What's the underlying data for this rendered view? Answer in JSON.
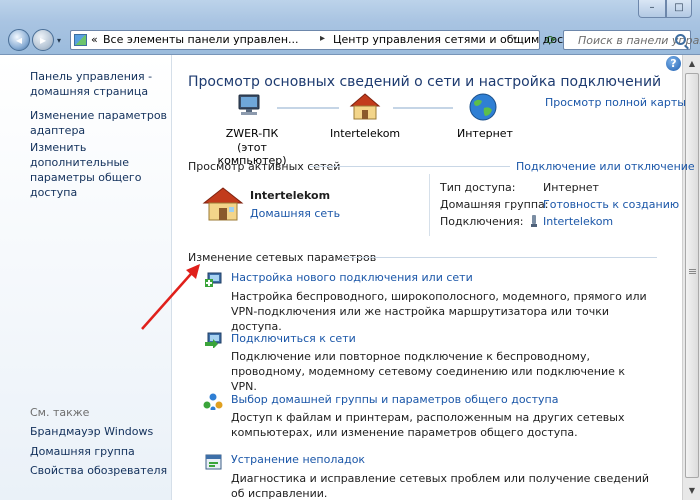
{
  "window": {
    "min_label": "–",
    "max_label": "□"
  },
  "address": {
    "crumb_prefix": "«",
    "crumb1": "Все элементы панели управлен...",
    "crumb2": "Центр управления сетями и общим доступом",
    "sep": "▸"
  },
  "search": {
    "placeholder": "Поиск в панели управлен"
  },
  "sidebar": {
    "home_link": "Панель управления -\nдомашняя страница",
    "items": [
      "Изменение параметров адаптера",
      "Изменить дополнительные параметры общего доступа"
    ],
    "see_also_heading": "См. также",
    "see_also": [
      "Брандмауэр Windows",
      "Домашняя группа",
      "Свойства обозревателя"
    ]
  },
  "main": {
    "title": "Просмотр основных сведений о сети и настройка подключений",
    "fullmap_link": "Просмотр полной карты",
    "map": {
      "computer_name": "ZWER-ПК",
      "computer_sub": "(этот компьютер)",
      "network_name": "Intertelekom",
      "internet_name": "Интернет"
    },
    "active_networks": {
      "label": "Просмотр активных сетей",
      "connect_link": "Подключение или отключение",
      "network_name": "Intertelekom",
      "network_type": "Домашняя сеть",
      "access_type_label": "Тип доступа:",
      "access_type_value": "Интернет",
      "homegroup_label": "Домашняя группа:",
      "homegroup_value": "Готовность к созданию",
      "connections_label": "Подключения:",
      "connections_value": "Intertelekom"
    },
    "change_settings": {
      "label": "Изменение сетевых параметров",
      "tasks": [
        {
          "title": "Настройка нового подключения или сети",
          "desc": "Настройка беспроводного, широкополосного, модемного, прямого или VPN-подключения или же настройка маршрутизатора или точки доступа."
        },
        {
          "title": "Подключиться к сети",
          "desc": "Подключение или повторное подключение к беспроводному, проводному, модемному сетевому соединению или подключение к VPN."
        },
        {
          "title": "Выбор домашней группы и параметров общего доступа",
          "desc": "Доступ к файлам и принтерам, расположенным на других сетевых компьютерах, или изменение параметров общего доступа."
        },
        {
          "title": "Устранение неполадок",
          "desc": "Диагностика и исправление сетевых проблем или получение сведений об исправлении."
        }
      ]
    }
  },
  "colors": {
    "link": "#1a56a8",
    "title": "#1e3b70",
    "arrow": "#e0201b"
  }
}
